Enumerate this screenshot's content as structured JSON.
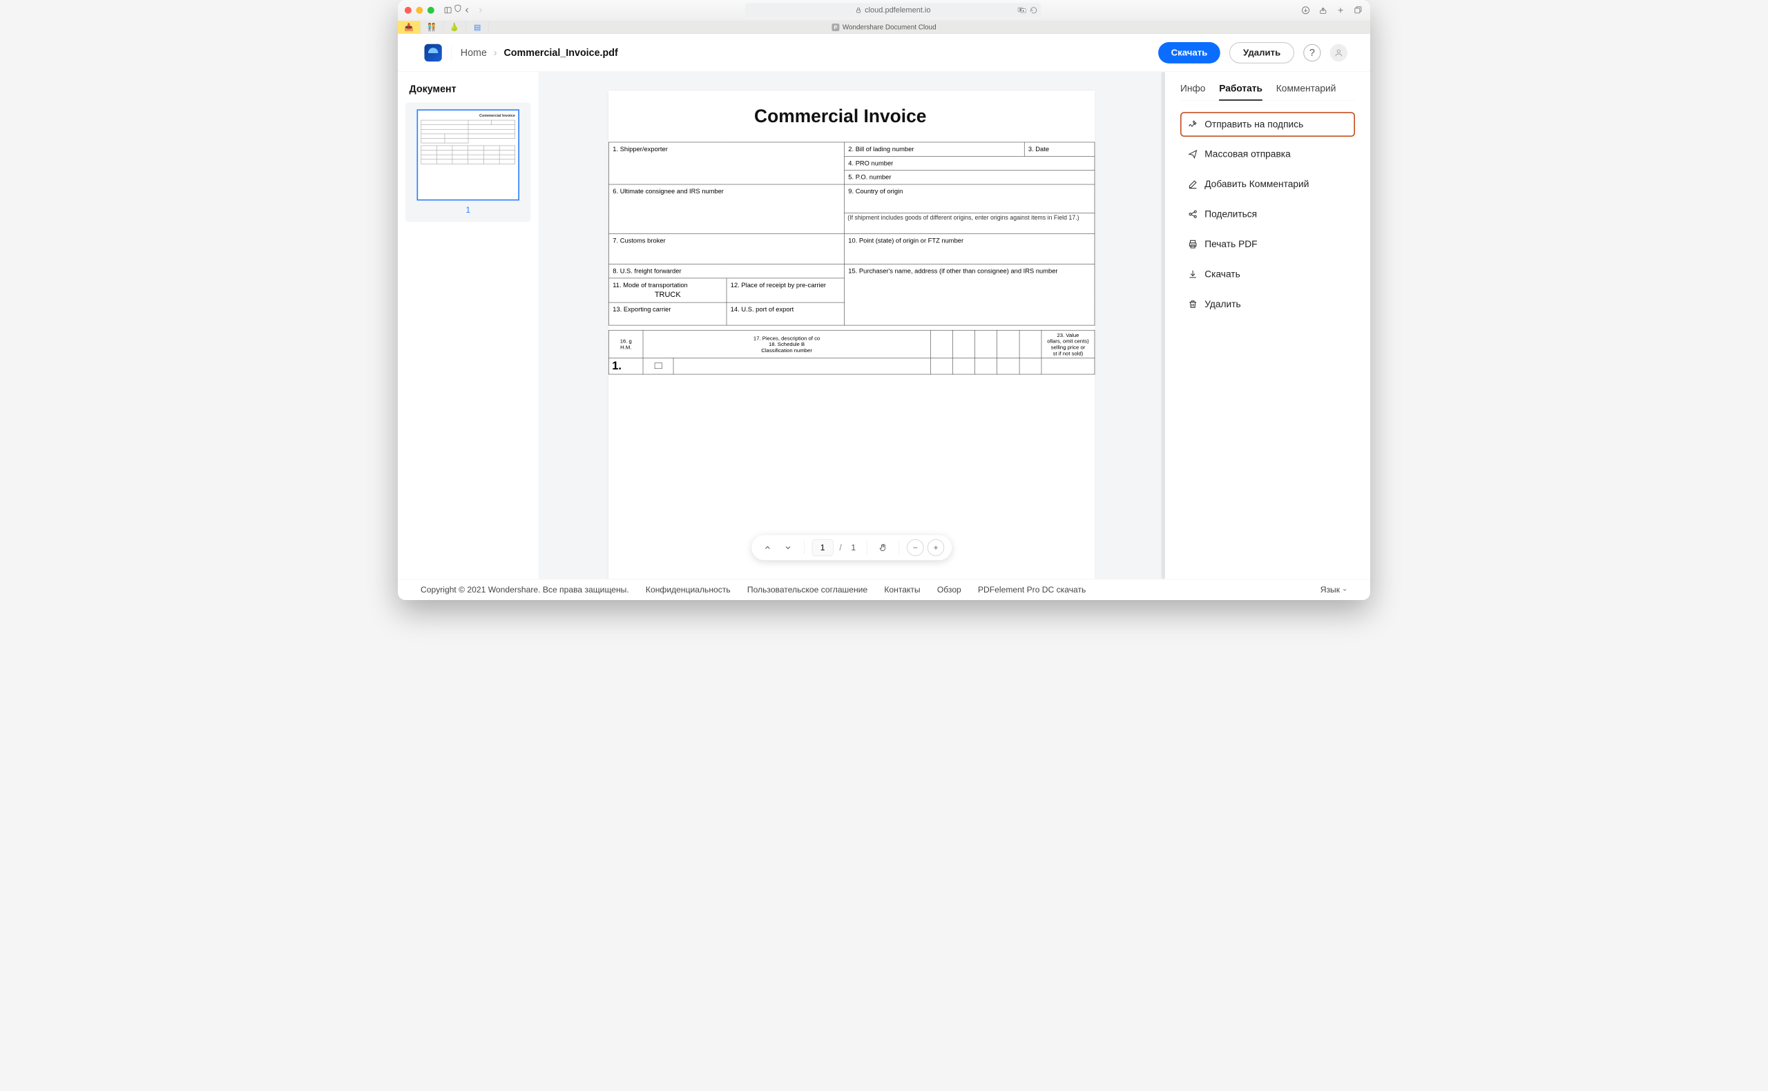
{
  "browser": {
    "url_host": "cloud.pdfelement.io",
    "tab_title": "Wondershare Document Cloud"
  },
  "header": {
    "breadcrumb_home": "Home",
    "breadcrumb_file": "Commercial_Invoice.pdf",
    "download_btn": "Скачать",
    "delete_btn": "Удалить",
    "help": "?"
  },
  "left": {
    "title": "Документ",
    "page_number": "1"
  },
  "document": {
    "title": "Commercial Invoice",
    "fields": {
      "f1": "1. Shipper/exporter",
      "f2": "2. Bill of lading number",
      "f3": "3. Date",
      "f4": "4. PRO number",
      "f5": "5. P.O. number",
      "f6": "6. Ultimate consignee and IRS number",
      "f9": "9. Country of origin",
      "f9_note": "(If shipment includes goods of different origins, enter origins against items in Field 17.)",
      "f7": "7. Customs broker",
      "f10": "10. Point (state) of origin or FTZ number",
      "f8": "8. U.S. freight forwarder",
      "f15": "15. Purchaser's name, address (if other than consignee) and IRS number",
      "f11": "11. Mode of transportation",
      "f11_val": "TRUCK",
      "f12": "12. Place of receipt by pre-carrier",
      "f13": "13. Exporting carrier",
      "f14": "14. U.S. port of export"
    },
    "item_headers": {
      "c16": "16. g\nH.M.",
      "c17": "17. Pieces, description of co",
      "c18": "18. Schedule B\nClassification number",
      "c23": "23. Value\nollars, omit cents)\nselling price or\nst if not sold)"
    },
    "row1": "1."
  },
  "pagebar": {
    "current": "1",
    "total": "1",
    "sep": "/"
  },
  "right": {
    "tabs": {
      "info": "Инфо",
      "work": "Работать",
      "comment": "Комментарий"
    },
    "actions": {
      "sign": "Отправить на подпись",
      "bulk": "Массовая отправка",
      "add_comment": "Добавить Комментарий",
      "share": "Поделиться",
      "print": "Печать PDF",
      "download": "Скачать",
      "delete": "Удалить"
    }
  },
  "footer": {
    "copyright": "Copyright © 2021 Wondershare. Все права защищены.",
    "privacy": "Конфиденциальность",
    "terms": "Пользовательское соглашение",
    "contacts": "Контакты",
    "overview": "Обзор",
    "download": "PDFelement Pro DC скачать",
    "language": "Язык"
  }
}
